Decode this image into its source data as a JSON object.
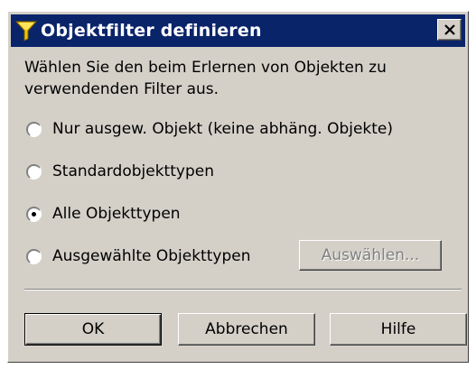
{
  "window": {
    "title": "Objektfilter definieren",
    "close_glyph": "✕",
    "title_icon": "funnel-icon"
  },
  "description": "Wählen Sie den beim Erlernen von Objekten zu verwendenden Filter aus.",
  "options": [
    {
      "label": "Nur ausgew. Objekt (keine abhäng. Objekte)",
      "checked": false
    },
    {
      "label": "Standardobjekttypen",
      "checked": false
    },
    {
      "label": "Alle Objekttypen",
      "checked": true
    },
    {
      "label": "Ausgewählte Objekttypen",
      "checked": false
    }
  ],
  "select_button": {
    "label": "Auswählen...",
    "enabled": false
  },
  "buttons": {
    "ok": "OK",
    "cancel": "Abbrechen",
    "help": "Hilfe"
  },
  "colors": {
    "titlebar": "#0a246a",
    "face": "#d4d0c8"
  }
}
